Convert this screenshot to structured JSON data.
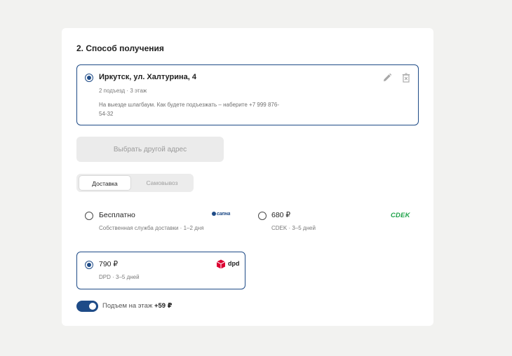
{
  "section": {
    "title": "2. Способ получения"
  },
  "address": {
    "title": "Иркутск, ул. Халтурина, 4",
    "details": "2 подъезд · 3 этаж",
    "note": "На выезде шлагбаум. Как будете подъезжать – наберите +7 999 876-54-32",
    "edit_icon": "pencil-icon",
    "delete_icon": "trash-icon"
  },
  "choose_address_label": "Выбрать другой адрес",
  "tabs": [
    {
      "label": "Доставка",
      "active": true
    },
    {
      "label": "Самовывоз",
      "active": false
    }
  ],
  "options": [
    {
      "title": "Бесплатно",
      "subtitle": "Собственная служба доставки · 1–2 дня",
      "logo": "сапна",
      "selected": false
    },
    {
      "title": "680 ₽",
      "subtitle": "CDEK · 3–5 дней",
      "logo": "CDEK",
      "selected": false
    },
    {
      "title": "790 ₽",
      "subtitle": "DPD · 3–5 дней",
      "logo": "dpd",
      "selected": true
    }
  ],
  "lift": {
    "label": "Подъем на этаж",
    "price": "+59 ₽",
    "enabled": true
  },
  "colors": {
    "accent": "#1e4b87",
    "cdek": "#1fa34a",
    "dpd": "#dc0032",
    "background": "#f2f2f0"
  }
}
